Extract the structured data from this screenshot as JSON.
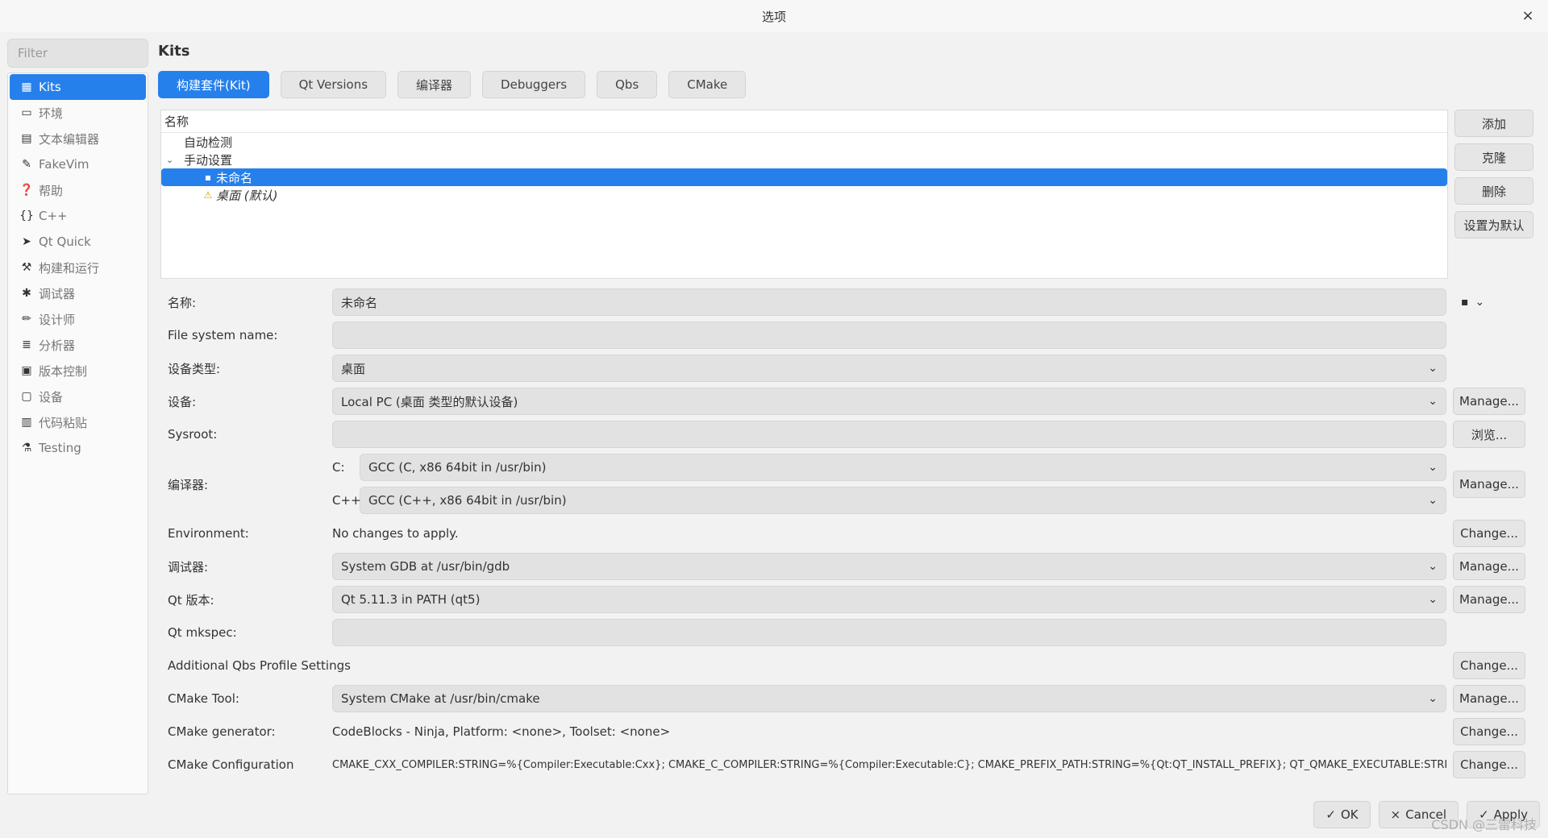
{
  "window": {
    "title": "选项",
    "close_glyph": "×"
  },
  "filter": {
    "placeholder": "Filter"
  },
  "categories": [
    {
      "label": "Kits",
      "icon": "kits-icon",
      "glyph": "▦"
    },
    {
      "label": "环境",
      "icon": "monitor-icon",
      "glyph": "▭"
    },
    {
      "label": "文本编辑器",
      "icon": "text-editor-icon",
      "glyph": "▤"
    },
    {
      "label": "FakeVim",
      "icon": "fakevim-icon",
      "glyph": "✎"
    },
    {
      "label": "帮助",
      "icon": "help-icon",
      "glyph": "❓"
    },
    {
      "label": "C++",
      "icon": "braces-icon",
      "glyph": "{}"
    },
    {
      "label": "Qt Quick",
      "icon": "paper-plane-icon",
      "glyph": "➤"
    },
    {
      "label": "构建和运行",
      "icon": "hammer-icon",
      "glyph": "⚒"
    },
    {
      "label": "调试器",
      "icon": "bug-icon",
      "glyph": "✱"
    },
    {
      "label": "设计师",
      "icon": "pencil-icon",
      "glyph": "✏"
    },
    {
      "label": "分析器",
      "icon": "analyzer-icon",
      "glyph": "≣"
    },
    {
      "label": "版本控制",
      "icon": "version-control-icon",
      "glyph": "▣"
    },
    {
      "label": "设备",
      "icon": "device-icon",
      "glyph": "▢"
    },
    {
      "label": "代码粘贴",
      "icon": "code-paste-icon",
      "glyph": "▥"
    },
    {
      "label": "Testing",
      "icon": "testing-icon",
      "glyph": "⚗"
    }
  ],
  "page_title": "Kits",
  "tabs": [
    "构建套件(Kit)",
    "Qt Versions",
    "编译器",
    "Debuggers",
    "Qbs",
    "CMake"
  ],
  "tree": {
    "header": "名称",
    "auto_detect": "自动检测",
    "manual": "手动设置",
    "collapse_glyph": "⌄",
    "kit_icon": "▪",
    "warn_icon": "⚠",
    "items": [
      "未命名",
      "桌面 (默认)"
    ]
  },
  "side_buttons": {
    "add": "添加",
    "clone": "克隆",
    "remove": "删除",
    "set_default": "设置为默认"
  },
  "form": {
    "name_label": "名称:",
    "name_value": "未命名",
    "device_icon_glyph": "▪",
    "chevron": "⌄",
    "fs_label": "File system name:",
    "fs_value": "",
    "device_type_label": "设备类型:",
    "device_type_value": "桌面",
    "device_label": "设备:",
    "device_value": "Local PC (桌面 类型的默认设备)",
    "sysroot_label": "Sysroot:",
    "sysroot_value": "",
    "compiler_label": "编译器:",
    "c_label": "C:",
    "c_value": "GCC (C, x86 64bit in /usr/bin)",
    "cpp_label": "C++:",
    "cpp_value": "GCC (C++, x86 64bit in /usr/bin)",
    "env_label": "Environment:",
    "env_value": "No changes to apply.",
    "debugger_label": "调试器:",
    "debugger_value": "System GDB at /usr/bin/gdb",
    "qt_version_label": "Qt 版本:",
    "qt_version_value": "Qt 5.11.3 in PATH (qt5)",
    "mkspec_label": "Qt mkspec:",
    "mkspec_value": "",
    "qbs_label": "Additional Qbs Profile Settings",
    "cmake_tool_label": "CMake Tool:",
    "cmake_tool_value": "System CMake at /usr/bin/cmake",
    "cmake_gen_label": "CMake generator:",
    "cmake_gen_value": "CodeBlocks - Ninja, Platform: <none>, Toolset: <none>",
    "cmake_conf_label": "CMake Configuration",
    "cmake_conf_value": "CMAKE_CXX_COMPILER:STRING=%{Compiler:Executable:Cxx}; CMAKE_C_COMPILER:STRING=%{Compiler:Executable:C}; CMAKE_PREFIX_PATH:STRING=%{Qt:QT_INSTALL_PREFIX}; QT_QMAKE_EXECUTABLE:STRI…",
    "manage": "Manage...",
    "browse": "浏览...",
    "change": "Change..."
  },
  "bottom": {
    "ok": "OK",
    "cancel": "Cancel",
    "apply": "Apply",
    "ok_glyph": "✓",
    "cancel_glyph": "×",
    "apply_glyph": "✓"
  },
  "watermark": "CSDN @三雷科技",
  "colors": {
    "accent": "#2680eb"
  }
}
